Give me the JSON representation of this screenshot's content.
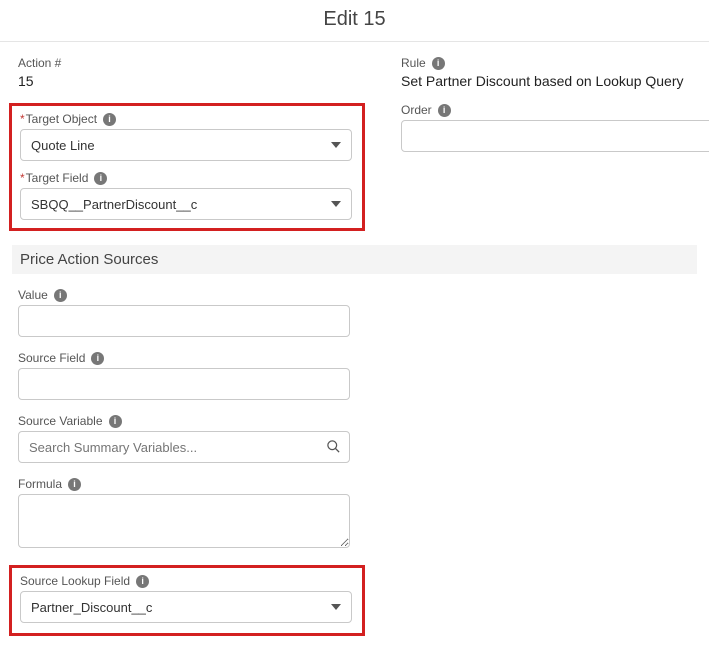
{
  "page_title": "Edit 15",
  "left": {
    "action_num": {
      "label": "Action #",
      "value": "15"
    },
    "target_object": {
      "label": "Target Object",
      "value": "Quote Line"
    },
    "target_field": {
      "label": "Target Field",
      "value": "SBQQ__PartnerDiscount__c"
    }
  },
  "right": {
    "rule": {
      "label": "Rule",
      "value": "Set Partner Discount based on Lookup Query"
    },
    "order": {
      "label": "Order",
      "value": ""
    }
  },
  "section_sources": "Price Action Sources",
  "sources": {
    "value": {
      "label": "Value",
      "value": ""
    },
    "source_field": {
      "label": "Source Field",
      "value": ""
    },
    "source_variable": {
      "label": "Source Variable",
      "placeholder": "Search Summary Variables..."
    },
    "formula": {
      "label": "Formula",
      "value": ""
    },
    "source_lookup_field": {
      "label": "Source Lookup Field",
      "value": "Partner_Discount__c"
    }
  }
}
